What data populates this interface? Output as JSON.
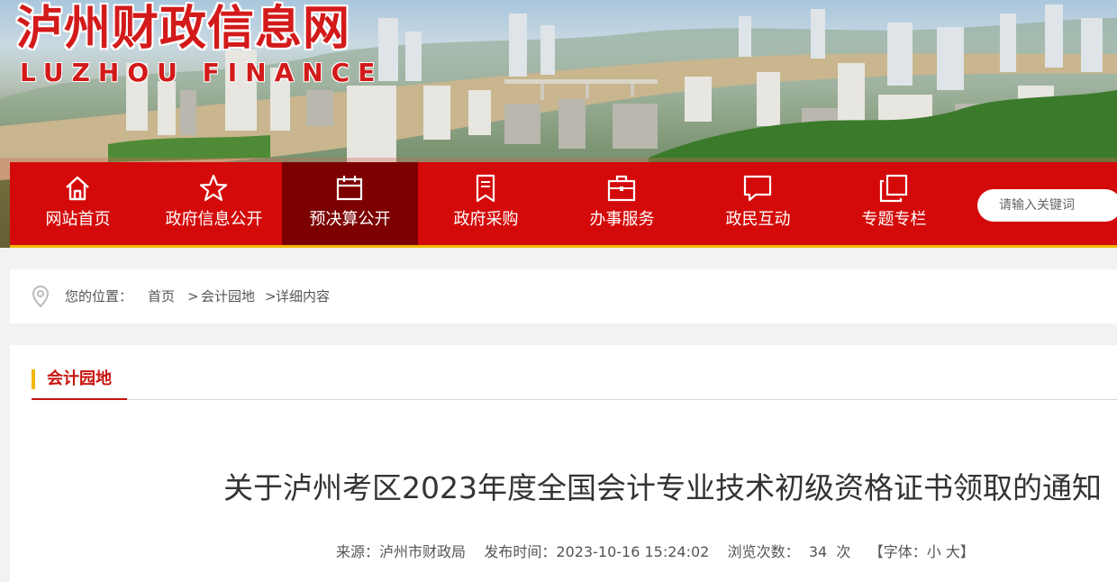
{
  "site": {
    "title": "泸州财政信息网",
    "subtitle": "LUZHOU FINANCE"
  },
  "nav": {
    "items": [
      {
        "label": "网站首页",
        "icon": "home-icon"
      },
      {
        "label": "政府信息公开",
        "icon": "star-icon"
      },
      {
        "label": "预决算公开",
        "icon": "calendar-icon",
        "active": true
      },
      {
        "label": "政府采购",
        "icon": "bookmark-icon"
      },
      {
        "label": "办事服务",
        "icon": "briefcase-icon"
      },
      {
        "label": "政民互动",
        "icon": "chat-icon"
      },
      {
        "label": "专题专栏",
        "icon": "layers-icon"
      }
    ],
    "search_placeholder": "请输入关键词"
  },
  "breadcrumb": {
    "prefix": "您的位置：",
    "home": "首页",
    "sep1": ">",
    "section": "会计园地",
    "sep2": ">",
    "current": "详细内容"
  },
  "section": {
    "title": "会计园地"
  },
  "article": {
    "title": "关于泸州考区2023年度全国会计专业技术初级资格证书领取的通知",
    "source_label": "来源：",
    "source": "泸州市财政局",
    "published_label": "发布时间：",
    "published": "2023-10-16 15:24:02",
    "views_label": "浏览次数：",
    "views": "34",
    "views_unit": "次",
    "font_label": "【字体：",
    "font_small": "小",
    "font_large": "大",
    "font_close": "】"
  },
  "colors": {
    "brand_red": "#d40a0a",
    "active_nav": "#7c0000",
    "accent_gold": "#f2b705",
    "section_red": "#c8140f"
  }
}
